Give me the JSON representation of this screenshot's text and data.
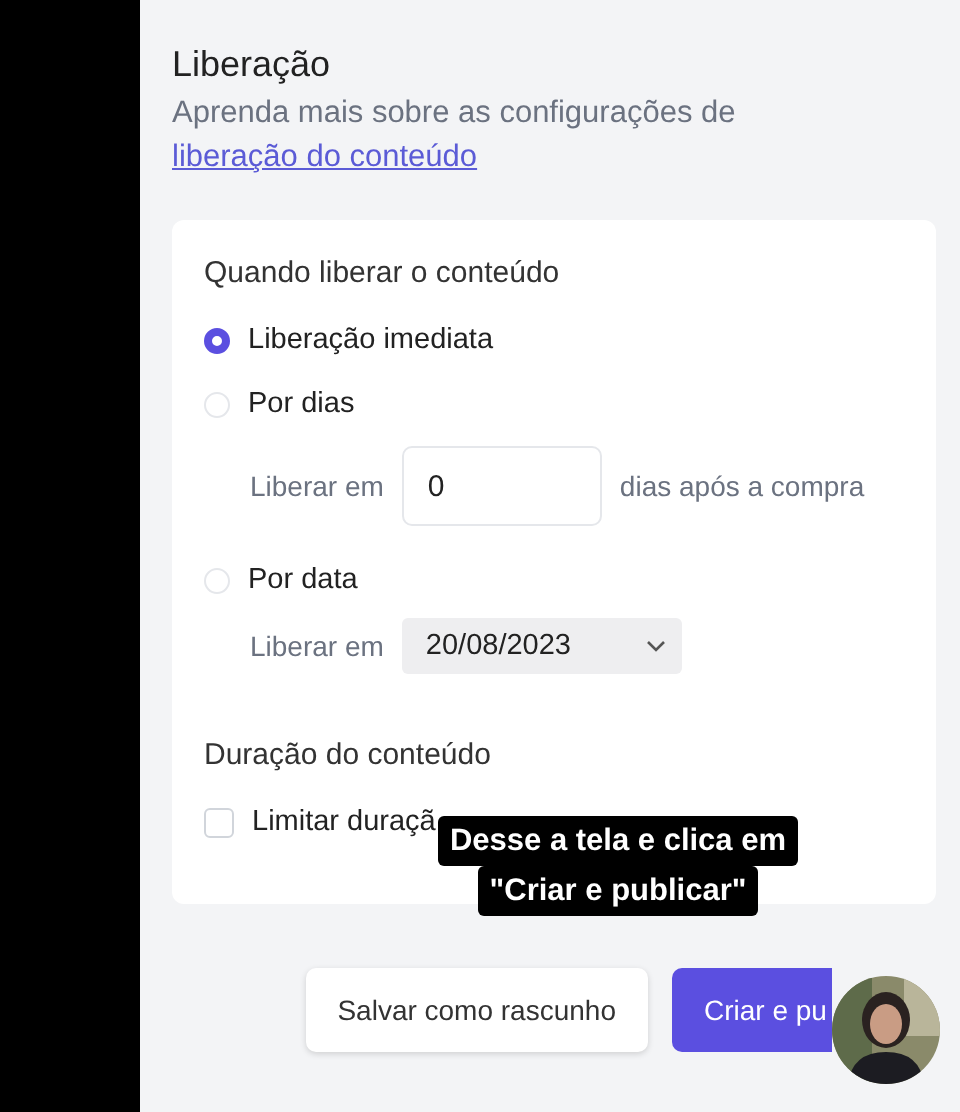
{
  "section": {
    "title": "Liberação",
    "description": "Aprenda mais sobre as configurações de ",
    "link": "liberação do conteúdo"
  },
  "release": {
    "heading": "Quando liberar o conteúdo",
    "options": [
      {
        "label": "Liberação imediata",
        "selected": true
      },
      {
        "label": "Por dias",
        "selected": false,
        "field": {
          "kind": "number",
          "label": "Liberar em",
          "value": "0",
          "suffix": "dias após a compra"
        }
      },
      {
        "label": "Por data",
        "selected": false,
        "field": {
          "kind": "date",
          "label": "Liberar em",
          "value": "20/08/2023"
        }
      }
    ]
  },
  "duration": {
    "heading": "Duração do conteúdo",
    "checkbox": {
      "label": "Limitar duraçã",
      "checked": false
    }
  },
  "buttons": [
    {
      "label": "Salvar como rascunho",
      "kind": "secondary"
    },
    {
      "label": "Criar e pu",
      "kind": "primary"
    }
  ],
  "caption": [
    "Desse a tela e clica em",
    "\"Criar e publicar\""
  ]
}
